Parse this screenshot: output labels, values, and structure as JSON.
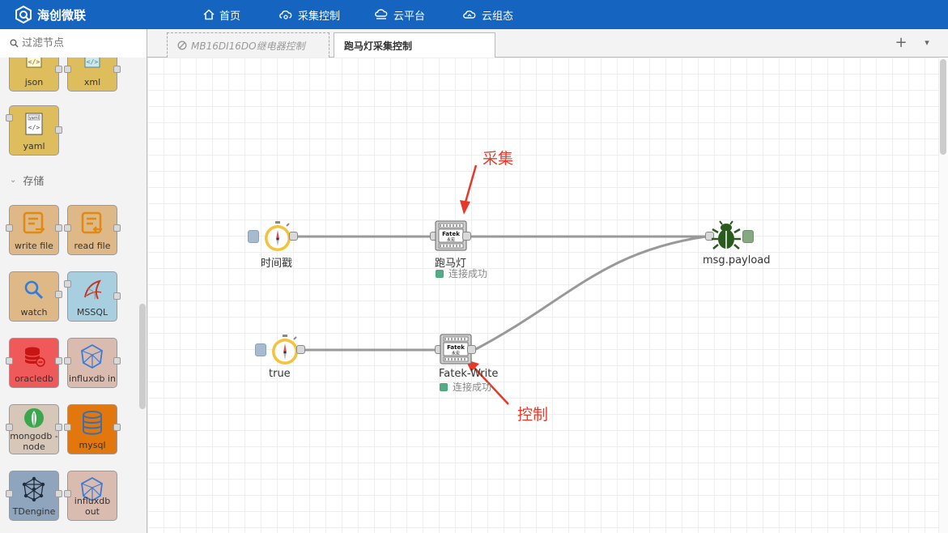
{
  "brand": {
    "name": "海创微联"
  },
  "nav": [
    {
      "label": "首页",
      "icon": "home-icon"
    },
    {
      "label": "采集控制",
      "icon": "cloud-gear-icon"
    },
    {
      "label": "云平台",
      "icon": "cloud-platform-icon"
    },
    {
      "label": "云组态",
      "icon": "cloud-config-icon"
    }
  ],
  "filter": {
    "placeholder": "过滤节点"
  },
  "tabs": [
    {
      "label": "MB16DI16DO继电器控制",
      "disabled": true
    },
    {
      "label": "跑马灯采集控制",
      "active": true
    }
  ],
  "tab_actions": {
    "add": "+",
    "menu": "▾"
  },
  "palette": {
    "nodes_top": [
      {
        "label": "json",
        "color": "#debd5c"
      },
      {
        "label": "xml",
        "color": "#debd5c"
      },
      {
        "label": "yaml",
        "color": "#debd5c"
      }
    ],
    "category": "存储",
    "nodes": [
      {
        "label": "write file",
        "color": "#deb887"
      },
      {
        "label": "read file",
        "color": "#deb887"
      },
      {
        "label": "watch",
        "color": "#deb887"
      },
      {
        "label": "MSSQL",
        "color": "#a8cfe0"
      },
      {
        "label": "oracledb",
        "color": "#f0595a"
      },
      {
        "label": "influxdb in",
        "color": "#d9bbb0"
      },
      {
        "label": "mongodb -\nnode",
        "color": "#d6c7b8"
      },
      {
        "label": "mysql",
        "color": "#e2770d"
      },
      {
        "label": "TDengine",
        "color": "#8fa5bd"
      },
      {
        "label": "influxdb out",
        "color": "#d9bbb0"
      }
    ]
  },
  "flow": {
    "nodes": {
      "inject1": {
        "label": "时间戳"
      },
      "fatek1": {
        "label": "跑马灯",
        "status": "连接成功",
        "badge": "Fatek",
        "sub": "永宏"
      },
      "debug": {
        "label": "msg.payload"
      },
      "inject2": {
        "label": "true"
      },
      "fatek2": {
        "label": "Fatek-Write",
        "status": "连接成功",
        "badge": "Fatek",
        "sub": "永宏"
      }
    },
    "annotations": {
      "collect": "采集",
      "control": "控制"
    },
    "colors": {
      "accent": "#1565c0",
      "annotation": "#e53a2a",
      "status": "#55aa88"
    }
  }
}
